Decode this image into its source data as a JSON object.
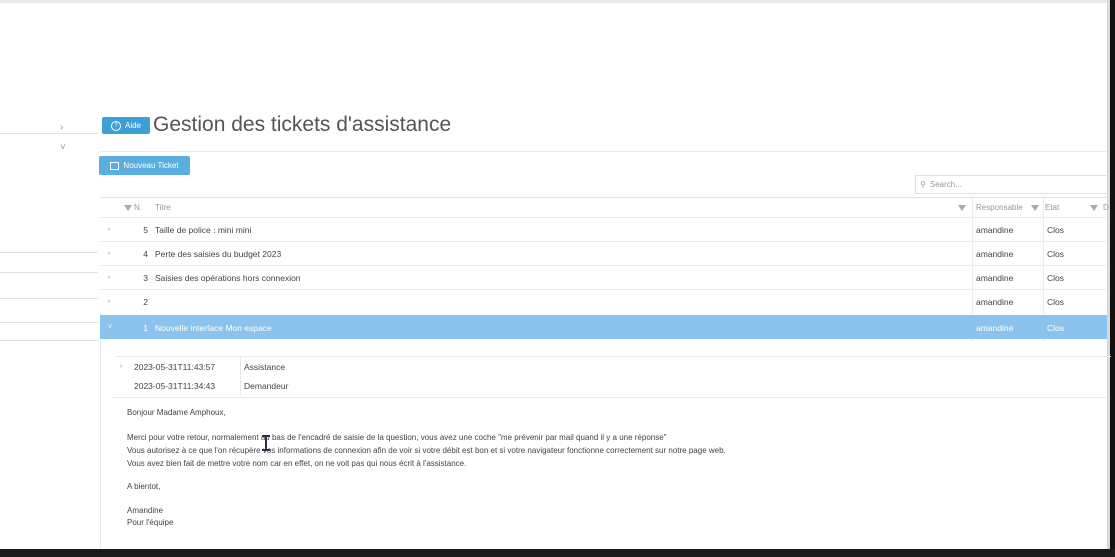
{
  "header": {
    "help_label": "Aide",
    "page_title": "Gestion des tickets d'assistance"
  },
  "toolbar": {
    "new_ticket_label": "Nouveau Ticket",
    "search_placeholder": "Search..."
  },
  "grid": {
    "columns": [
      "N.",
      "Titre",
      "Responsable",
      "Etat",
      "D"
    ],
    "rows": [
      {
        "num": "5",
        "title": "Taille de police : mini mini",
        "responsable": "amandine",
        "etat": "Clos"
      },
      {
        "num": "4",
        "title": "Perte des saisies du budget 2023",
        "responsable": "amandine",
        "etat": "Clos"
      },
      {
        "num": "3",
        "title": "Saisies des opérations hors connexion",
        "responsable": "amandine",
        "etat": "Clos"
      },
      {
        "num": "2",
        "title": "",
        "responsable": "amandine",
        "etat": "Clos"
      },
      {
        "num": "1",
        "title": "Nouvelle interface Mon espace",
        "responsable": "amandine",
        "etat": "Clos"
      }
    ]
  },
  "detail": {
    "history": [
      {
        "date": "2023-05-31T11:43:57",
        "type": "Assistance"
      },
      {
        "date": "2023-05-31T11:34:43",
        "type": "Demandeur"
      }
    ],
    "message_lines": [
      "Bonjour Madame Amphoux,",
      "Merci pour votre retour, normalement au bas de l'encadré de saisie de la question, vous avez une coche \"me prévenir par mail quand il y a une réponse\"",
      "Vous autorisez à ce que l'on récupère vos informations de connexion afin de voir si votre débit est bon et si votre navigateur fonctionne correctement sur notre page web.",
      "Vous avez bien fait de mettre votre nom car en effet, on ne voit pas qui nous écrit à l'assistance.",
      "A bientot,",
      "Amandine",
      "Pour l'équipe"
    ]
  },
  "colors": {
    "accent": "#3d9fd6",
    "selected_row": "#8bc3ec"
  }
}
